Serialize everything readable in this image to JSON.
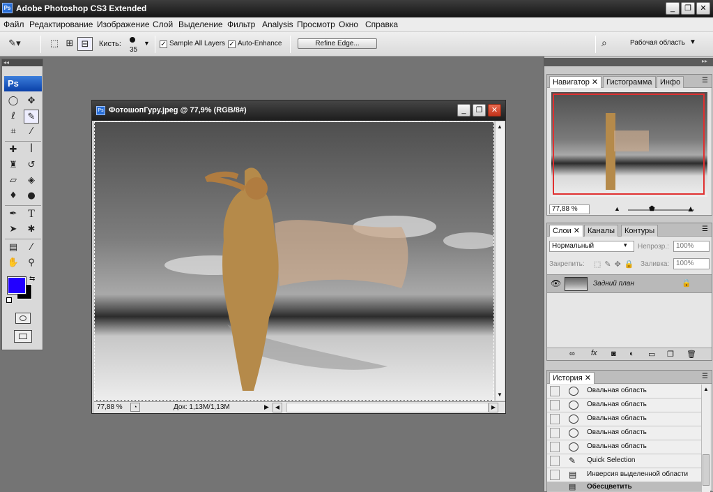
{
  "app": {
    "title": "Adobe Photoshop CS3 Extended",
    "icon_text": "Ps"
  },
  "window_controls": {
    "minimize": "_",
    "restore": "❐",
    "close": "✕"
  },
  "menu": [
    "Файл",
    "Редактирование",
    "Изображение",
    "Слой",
    "Выделение",
    "Фильтр",
    "Analysis",
    "Просмотр",
    "Окно",
    "Справка"
  ],
  "options_bar": {
    "brush_label": "Кисть:",
    "brush_size": "35",
    "sample_all_layers": {
      "label": "Sample All Layers",
      "checked": true
    },
    "auto_enhance": {
      "label": "Auto-Enhance",
      "checked": true
    },
    "refine_edge": "Refine Edge...",
    "workspace": "Рабочая область"
  },
  "toolbox": {
    "logo": "Ps",
    "tools": [
      "marquee-tool",
      "move-tool",
      "lasso-tool",
      "quick-selection-tool",
      "crop-tool",
      "slice-tool",
      "healing-brush-tool",
      "brush-tool",
      "clone-stamp-tool",
      "history-brush-tool",
      "eraser-tool",
      "paint-bucket-tool",
      "blur-tool",
      "dodge-tool",
      "pen-tool",
      "type-tool",
      "path-selection-tool",
      "custom-shape-tool",
      "notes-tool",
      "eyedropper-tool",
      "hand-tool",
      "zoom-tool"
    ],
    "foreground_color": "#2200ff",
    "background_color": "#000000"
  },
  "document": {
    "title": "ФотошопГуру.jpeg @ 77,9% (RGB/8#)",
    "zoom": "77,88 %",
    "doc_info": "Док: 1,13M/1,13M"
  },
  "navigator": {
    "tabs": [
      "Навигатор",
      "Гистограмма",
      "Инфо"
    ],
    "zoom": "77,88 %"
  },
  "layers": {
    "tabs": [
      "Слои",
      "Каналы",
      "Контуры"
    ],
    "blend_mode": "Нормальный",
    "opacity_label": "Непрозр.:",
    "opacity": "100%",
    "lock_label": "Закрепить:",
    "fill_label": "Заливка:",
    "fill": "100%",
    "layer_name": "Задний план"
  },
  "history": {
    "tab": "История",
    "items": [
      "Овальная область",
      "Овальная область",
      "Овальная область",
      "Овальная область",
      "Овальная область",
      "Quick Selection",
      "Инверсия выделенной области",
      "Обесцветить"
    ]
  }
}
